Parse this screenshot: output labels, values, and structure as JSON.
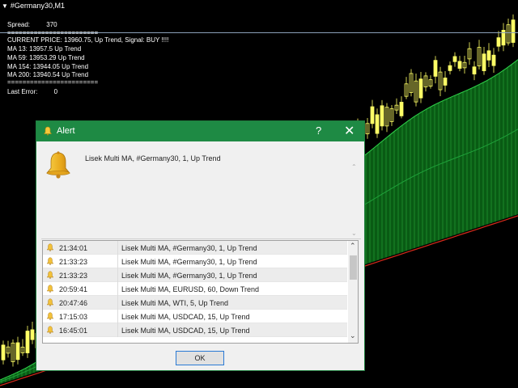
{
  "chart": {
    "symbol_title": "#Germany30,M1",
    "spread_label": "Spread:",
    "spread_value": "370",
    "separator": "========================",
    "current_price_line": "CURRENT PRICE:  13960.75, Up Trend, Signal: BUY !!!!",
    "ma13": "MA 13:  13957.5  Up Trend",
    "ma59": "MA 59:  13953.29  Up Trend",
    "ma154": "MA 154:  13944.05  Up Trend",
    "ma200": "MA 200:  13940.54  Up Trend",
    "separator2": "========================",
    "last_error_label": "Last Error:",
    "last_error_value": "0"
  },
  "dialog": {
    "title": "Alert",
    "help_icon": "?",
    "close_icon": "✕",
    "message": "Lisek Multi MA, #Germany30, 1, Up Trend",
    "rows": [
      {
        "time": "21:34:01",
        "text": "Lisek Multi MA, #Germany30, 1, Up Trend"
      },
      {
        "time": "21:33:23",
        "text": "Lisek Multi MA, #Germany30, 1, Up Trend"
      },
      {
        "time": "21:33:23",
        "text": "Lisek Multi MA, #Germany30, 1, Up Trend"
      },
      {
        "time": "20:59:41",
        "text": "Lisek Multi MA, EURUSD, 60, Down Trend"
      },
      {
        "time": "20:47:46",
        "text": "Lisek Multi MA, WTI, 5, Up Trend"
      },
      {
        "time": "17:15:03",
        "text": "Lisek Multi MA, USDCAD, 15, Up Trend"
      },
      {
        "time": "16:45:01",
        "text": "Lisek Multi MA, USDCAD, 15, Up Trend"
      }
    ],
    "ok_label": "OK"
  },
  "colors": {
    "title_bar": "#1e8a44",
    "candle_up": "#ffff66",
    "band_fill": "#0b6b17",
    "ma_red": "#d62b1a"
  }
}
